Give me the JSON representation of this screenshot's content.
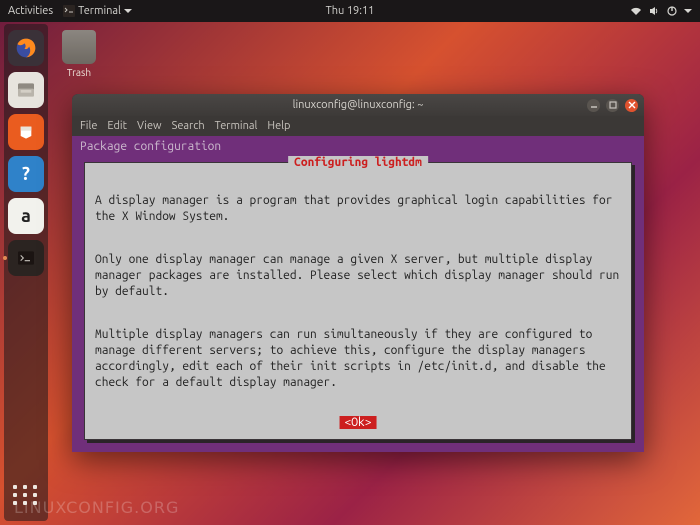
{
  "topbar": {
    "activities": "Activities",
    "app_indicator": "Terminal",
    "clock": "Thu 19:11"
  },
  "desktop": {
    "trash_label": "Trash"
  },
  "dock": {
    "help_glyph": "?",
    "amazon_glyph": "a"
  },
  "window": {
    "title": "linuxconfig@linuxconfig: ~",
    "menu": {
      "file": "File",
      "edit": "Edit",
      "view": "View",
      "search": "Search",
      "terminal": "Terminal",
      "help": "Help"
    }
  },
  "tui": {
    "header": "Package configuration",
    "dialog_title": "Configuring lightdm",
    "p1": "A display manager is a program that provides graphical login capabilities for the X Window System.",
    "p2": "Only one display manager can manage a given X server, but multiple display manager packages are installed. Please select which display manager should run by default.",
    "p3": "Multiple display managers can run simultaneously if they are configured to manage different servers; to achieve this, configure the display managers accordingly, edit each of their init scripts in /etc/init.d, and disable the check for a default display manager.",
    "ok": "Ok"
  },
  "watermark": "LINUXCONFIG.ORG"
}
